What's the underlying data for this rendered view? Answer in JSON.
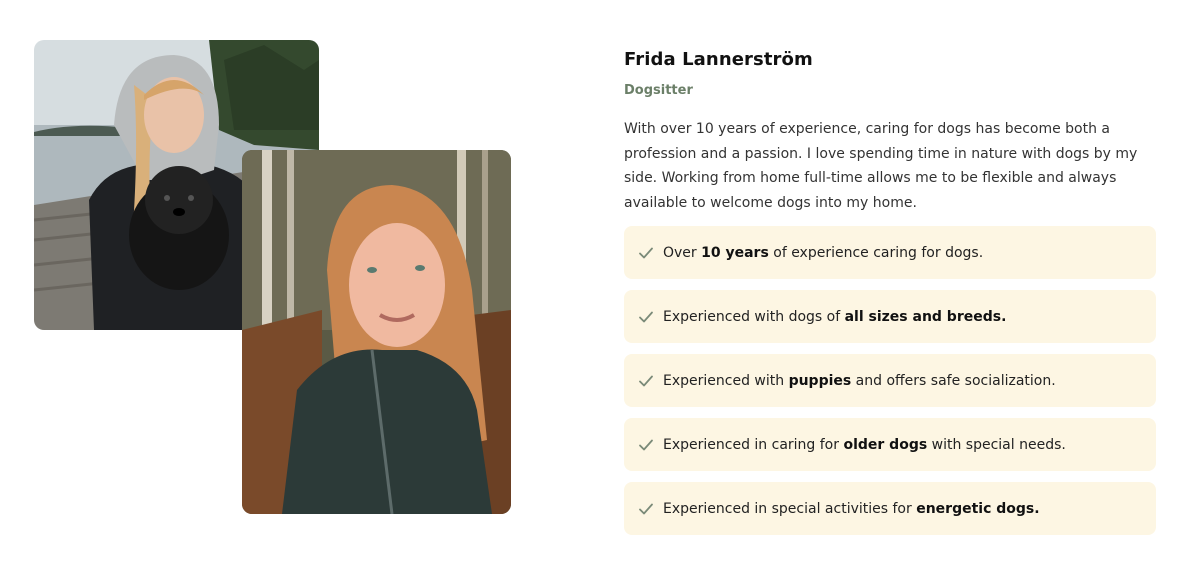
{
  "profile": {
    "name": "Frida Lannerström",
    "role": "Dogsitter",
    "bio": "With over 10 years of experience, caring for dogs has become both a profession and a passion. I love spending time in nature with dogs by my side. Working from home full-time allows me to be flexible and always available to welcome dogs into my home."
  },
  "features": [
    {
      "before": "Over ",
      "bold": "10 years",
      "after": " of experience caring for dogs."
    },
    {
      "before": "Experienced with dogs of ",
      "bold": "all sizes and breeds.",
      "after": ""
    },
    {
      "before": "Experienced with ",
      "bold": "puppies",
      "after": " and offers safe socialization."
    },
    {
      "before": "Experienced in caring for ",
      "bold": "older dogs",
      "after": " with special needs."
    },
    {
      "before": "Experienced in special activities for ",
      "bold": "energetic dogs.",
      "after": ""
    }
  ],
  "icons": {
    "feature_icon": "check-icon"
  },
  "colors": {
    "feature_background": "#fdf6e3",
    "role_text": "#6b7f68",
    "check_icon": "#7a8a78"
  }
}
